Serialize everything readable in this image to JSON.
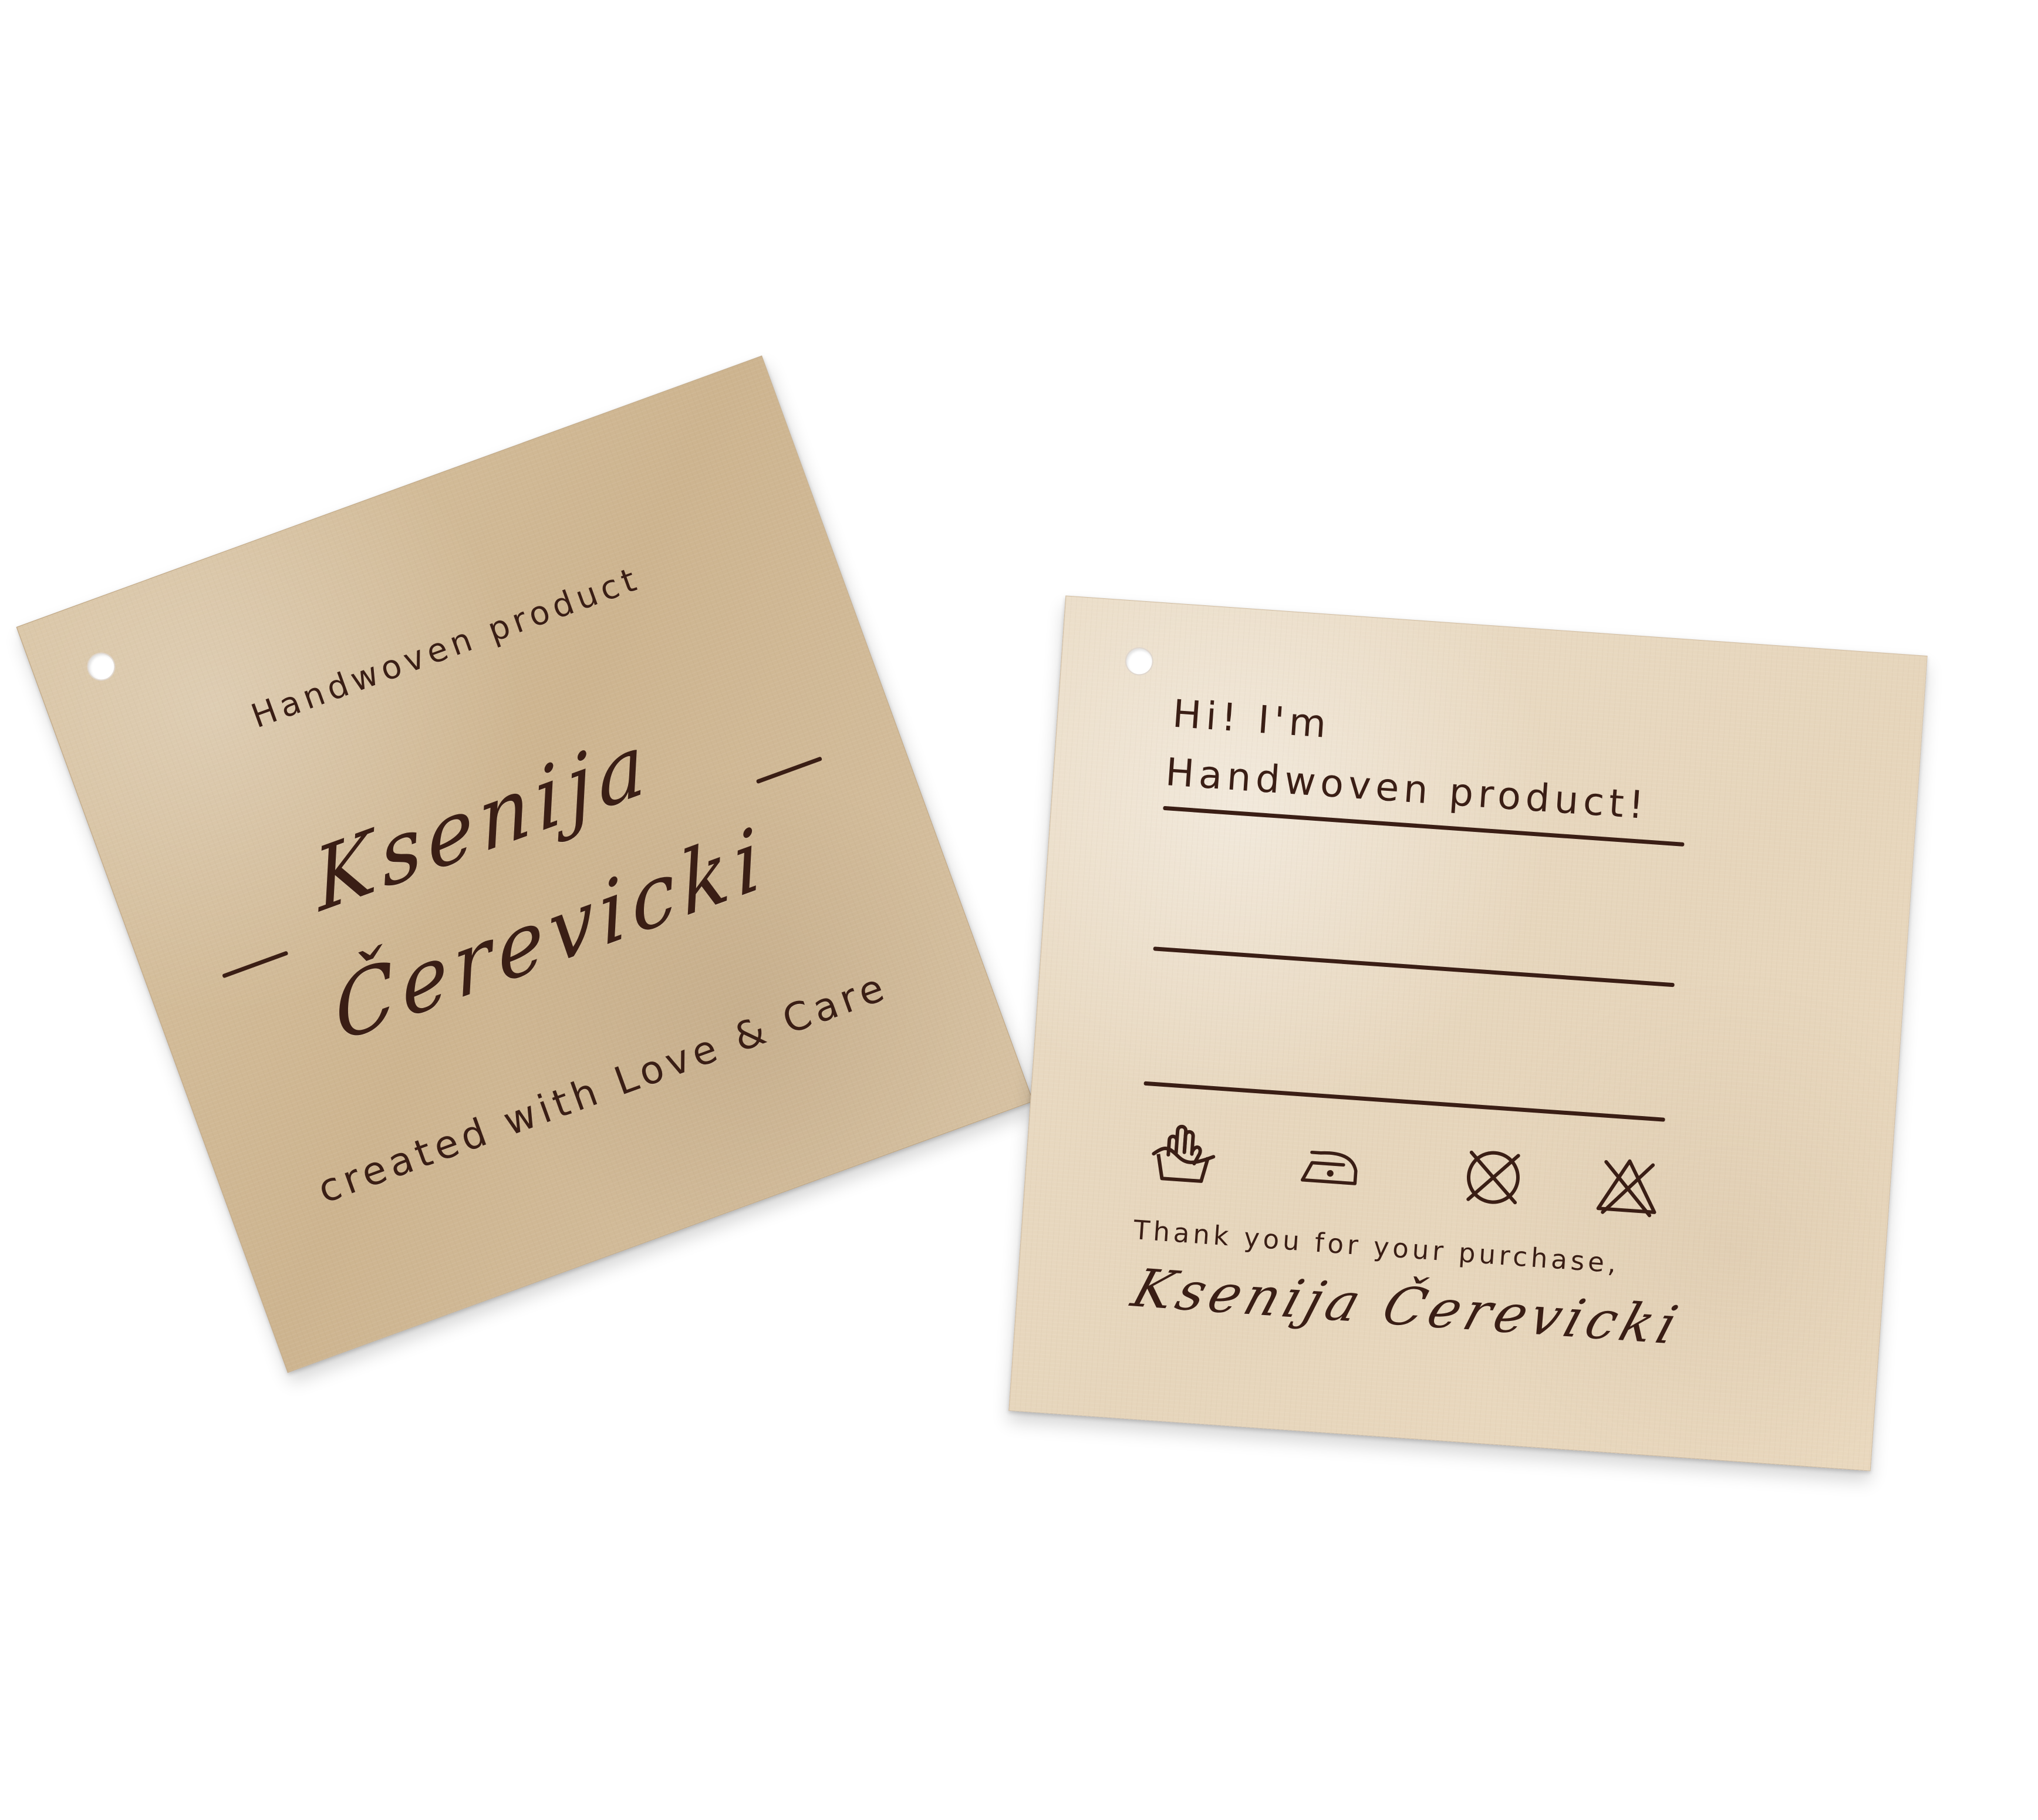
{
  "scene": {
    "background": "#ffffff",
    "primary_text_color": "#3a1e15",
    "left_tag_color": "#d3bc99",
    "right_tag_color": "#e7d6bc"
  },
  "left_tag": {
    "top_text": "Handwoven product",
    "name_line_1": "Ksenija",
    "name_line_2": "Čerevicki",
    "bottom_text": "created with Love & Care"
  },
  "right_tag": {
    "greeting": "Hi! I'm",
    "headline": "Handwoven product!",
    "care_icons": [
      "hand-wash-icon",
      "iron-low-heat-icon",
      "no-dry-clean-icon",
      "no-bleach-icon"
    ],
    "thanks": "Thank you for your purchase,",
    "signature": "Ksenija Čerevicki"
  }
}
